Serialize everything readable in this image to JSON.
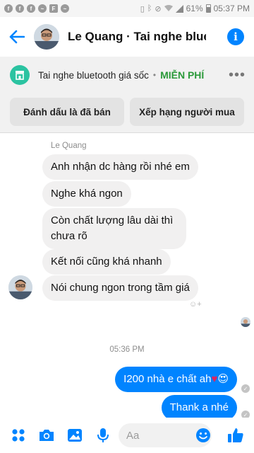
{
  "status_bar": {
    "battery": "61%",
    "time": "05:37 PM"
  },
  "header": {
    "title": "Le Quang · Tai nghe bluetooth giá sốc"
  },
  "product": {
    "name": "Tai nghe bluetooth giá sốc",
    "separator": "•",
    "price": "MIỄN PHÍ",
    "more": "•••",
    "mark_sold_label": "Đánh dấu là đã bán",
    "rate_buyer_label": "Xếp hạng người mua"
  },
  "chat": {
    "sender_name": "Le Quang",
    "incoming": [
      "Anh nhận dc hàng rồi nhé em",
      "Nghe khá ngon",
      "Còn chất lượng lâu dài thì chưa rõ",
      "Kết nối cũng khá nhanh",
      "Nói chung ngon trong tầm giá"
    ],
    "timestamp": "05:36 PM",
    "outgoing": [
      "I200 nhà e chất ah",
      "Thank a nhé"
    ]
  },
  "composer": {
    "placeholder": "Aa"
  },
  "colors": {
    "accent": "#0084ff",
    "price_green": "#2b9a3a",
    "shop_icon": "#2bc3a1",
    "bubble_in": "#f1f0f0"
  },
  "icons": [
    "facebook-icon",
    "messenger-icon",
    "flipboard-icon",
    "vibrate-icon",
    "bluetooth-icon",
    "wifi-icon",
    "signal-icon",
    "battery-icon",
    "back-arrow-icon",
    "info-icon",
    "shop-icon",
    "more-icon",
    "apps-icon",
    "camera-icon",
    "gallery-icon",
    "microphone-icon",
    "emoji-icon",
    "thumbs-up-icon",
    "heart-emoji",
    "heart-eyes-emoji"
  ]
}
